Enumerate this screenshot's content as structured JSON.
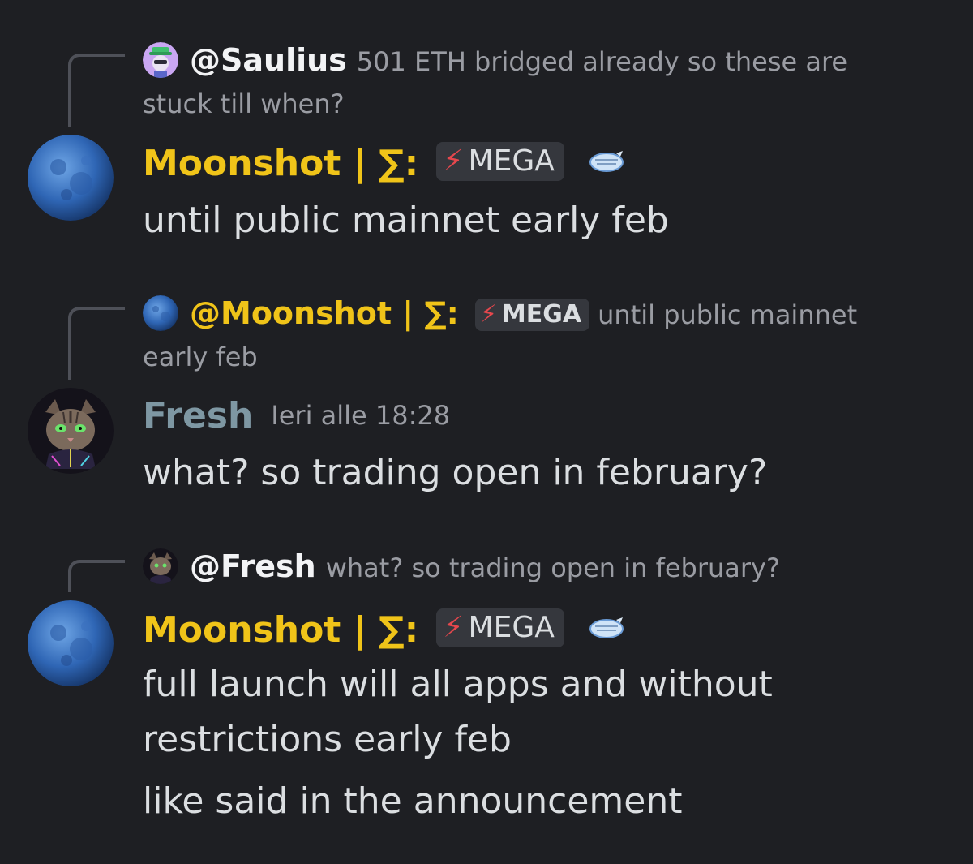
{
  "messages": [
    {
      "reply": {
        "name": "@Saulius",
        "text": "501 ETH bridged already so these are stuck till when?"
      },
      "author": "Moonshot | ∑:",
      "role": "MEGA",
      "lines": [
        "until public mainnet early feb"
      ]
    },
    {
      "reply": {
        "name": "@Moonshot | ∑:",
        "role": "MEGA",
        "text": "until public mainnet early feb"
      },
      "author": "Fresh",
      "timestamp": "Ieri alle 18:28",
      "lines": [
        "what? so trading open in february?"
      ]
    },
    {
      "reply": {
        "name": "@Fresh",
        "text": "what? so trading open in february?"
      },
      "author": "Moonshot | ∑:",
      "role": "MEGA",
      "lines": [
        "full launch will all apps and without restrictions early feb",
        "like said in the announcement"
      ]
    }
  ],
  "icons": {
    "role_icon": "lightning-bolt-icon",
    "side_badge": "planet-badge-icon"
  },
  "colors": {
    "background": "#1e1f23",
    "moonshot_name": "#f0c419",
    "fresh_name": "#7e97a3",
    "bolt": "#e6474d",
    "muted_text": "#9a9ca3"
  }
}
